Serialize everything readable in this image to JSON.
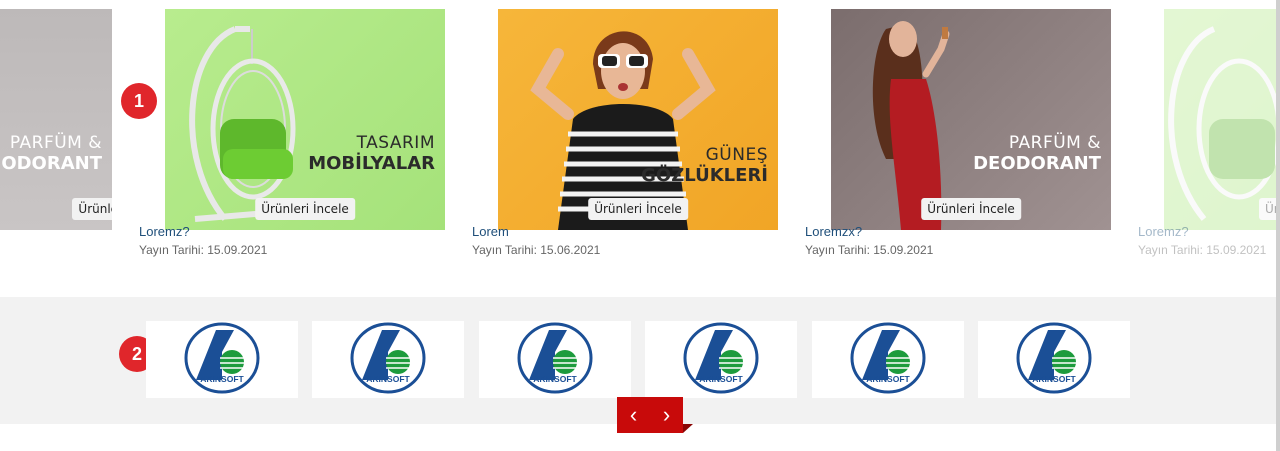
{
  "cards": [
    {
      "headline1": "PARFÜM &",
      "headline2": "DEODORANT",
      "button": "Ürünleri İncele",
      "title": "",
      "date": ""
    },
    {
      "headline1": "TASARIM",
      "headline2": "MOBİLYALAR",
      "button": "Ürünleri İncele",
      "title": "Loremz?",
      "date": "Yayın Tarihi: 15.09.2021"
    },
    {
      "headline1": "GÜNEŞ",
      "headline2": "GÖZLÜKLERİ",
      "button": "Ürünleri İncele",
      "title": "Lorem",
      "date": "Yayın Tarihi: 15.06.2021"
    },
    {
      "headline1": "PARFÜM &",
      "headline2": "DEODORANT",
      "button": "Ürünleri İncele",
      "title": "Loremzx?",
      "date": "Yayın Tarihi: 15.09.2021"
    },
    {
      "headline1": "",
      "headline2": "",
      "button": "Ürünleri İncele",
      "title": "Loremz?",
      "date": "Yayın Tarihi: 15.09.2021"
    }
  ],
  "badges": {
    "one": "1",
    "two": "2"
  },
  "brands": [
    {
      "name": "AKINSOFT"
    },
    {
      "name": "AKINSOFT"
    },
    {
      "name": "AKINSOFT"
    },
    {
      "name": "AKINSOFT"
    },
    {
      "name": "AKINSOFT"
    },
    {
      "name": "AKINSOFT"
    }
  ],
  "nav": {
    "prev": "‹",
    "next": "›"
  },
  "colors": {
    "accent": "#c80a0a",
    "badge": "#e0262b",
    "title": "#1f4f7a"
  },
  "icons": {
    "prev": "chevron-left-icon",
    "next": "chevron-right-icon",
    "logo": "akinsoft-logo"
  }
}
